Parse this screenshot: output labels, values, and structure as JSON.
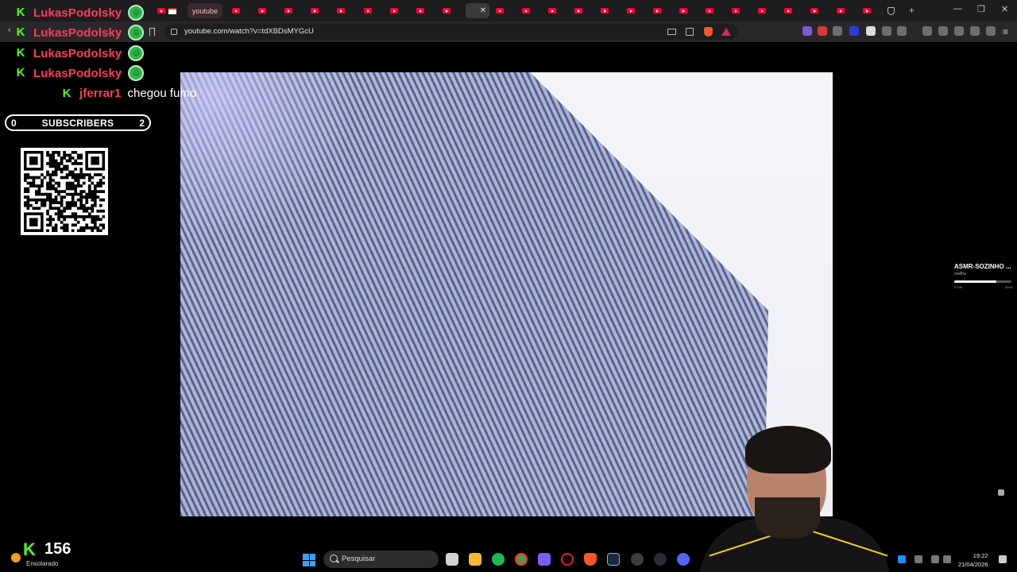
{
  "browser": {
    "active_tab_label": "youtube",
    "url": "youtube.com/watch?v=tdXBDsMYGcU"
  },
  "chat": {
    "messages": [
      {
        "user": "LukasPodolsky",
        "text": ""
      },
      {
        "user": "LukasPodolsky",
        "text": ""
      },
      {
        "user": "LukasPodolsky",
        "text": ""
      },
      {
        "user": "LukasPodolsky",
        "text": ""
      },
      {
        "user": "jferrar1",
        "text": "chegou fumo"
      }
    ]
  },
  "subscribers": {
    "left_value": "0",
    "label": "SUBSCRIBERS",
    "right_value": "2"
  },
  "now_playing": {
    "title": "ASMR-SOZINHO ...",
    "artist": "ovelha",
    "elapsed": "07:09",
    "duration": "09:41",
    "progress": 0.74
  },
  "viewers": {
    "count": "156"
  },
  "taskbar": {
    "weather": "Ensolarado",
    "search_placeholder": "Pesquisar",
    "time": "19:22",
    "date": "21/04/2026"
  },
  "colors": {
    "kick_green": "#53fc18",
    "username_red": "#ff3b5c",
    "youtube_red": "#ff0033"
  }
}
